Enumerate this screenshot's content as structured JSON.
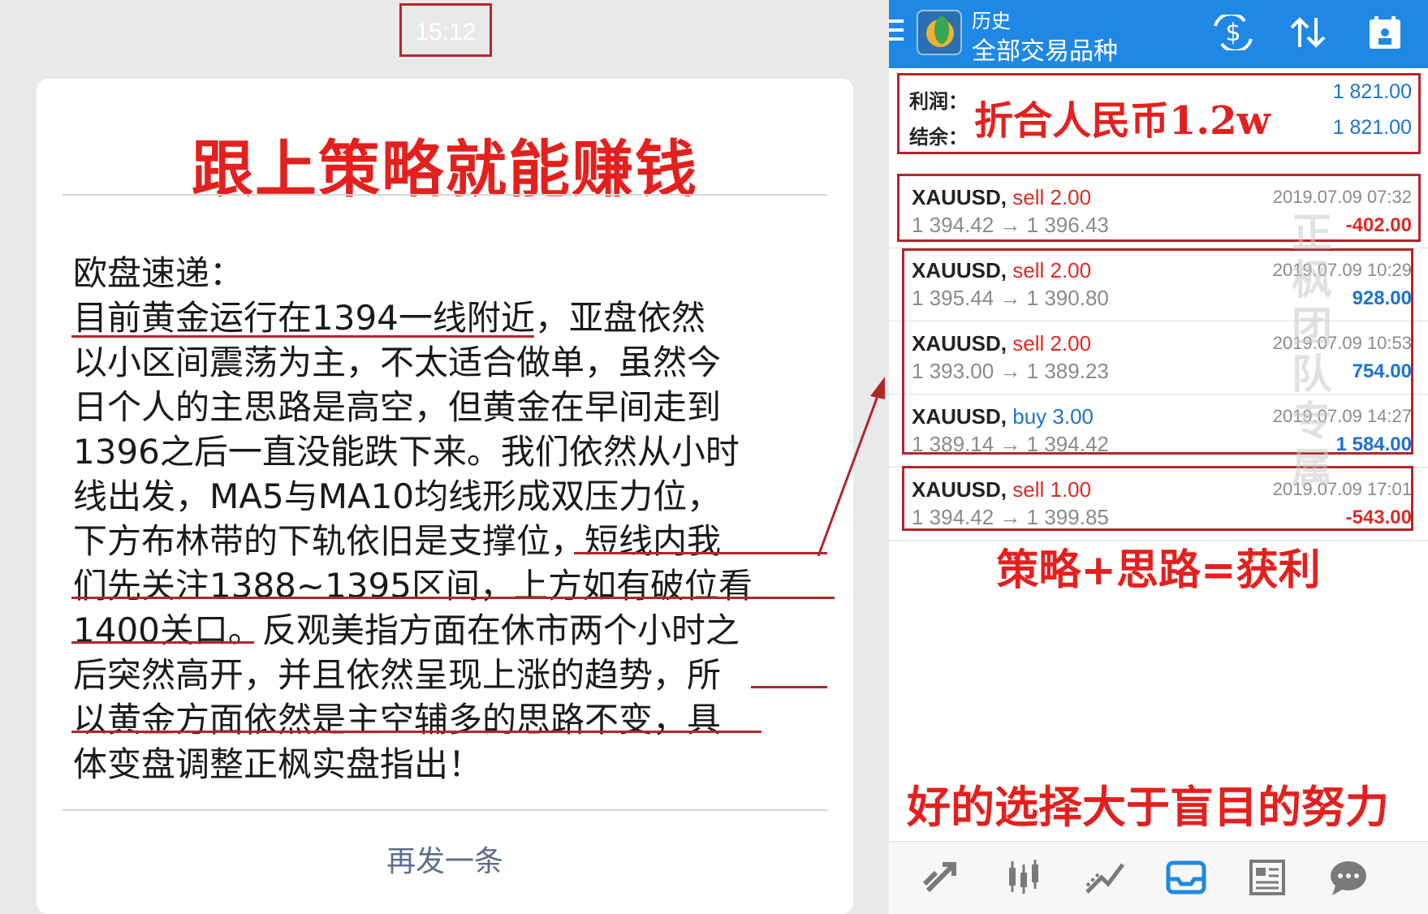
{
  "left": {
    "time": "15:12",
    "title": "跟上策略就能赚钱",
    "lines": [
      "欧盘速递：",
      "目前黄金运行在1394一线附近，亚盘依然",
      "以小区间震荡为主，不太适合做单，虽然今",
      "日个人的主思路是高空，但黄金在早间走到",
      "1396之后一直没能跌下来。我们依然从小时",
      "线出发，MA5与MA10均线形成双压力位，",
      "下方布林带的下轨依旧是支撑位，短线内我",
      "们先关注1388~1395区间，上方如有破位看",
      "1400关口。反观美指方面在休市两个小时之",
      "后突然高开，并且依然呈现上涨的趋势，所",
      "以黄金方面依然是主空辅多的思路不变，具",
      "体变盘调整正枫实盘指出！"
    ],
    "resend": "再发一条"
  },
  "app": {
    "title": "历史",
    "subtitle": "全部交易品种",
    "icons": [
      "currency-exchange-icon",
      "sort-icon",
      "calendar-icon"
    ],
    "summary": {
      "profit_label": "利润：",
      "balance_label": "结余：",
      "profit_value": "1 821.00",
      "balance_value": "1 821.00",
      "note": "折合人民币1.2w"
    },
    "trades": [
      {
        "symbol": "XAUUSD,",
        "side": "sell 2.00",
        "side_type": "sell",
        "prices": "1 394.42 → 1 396.43",
        "time": "2019.07.09 07:32",
        "profit": "-402.00",
        "profit_type": "neg"
      },
      {
        "symbol": "XAUUSD,",
        "side": "sell 2.00",
        "side_type": "sell",
        "prices": "1 395.44 → 1 390.80",
        "time": "2019.07.09 10:29",
        "profit": "928.00",
        "profit_type": "pos"
      },
      {
        "symbol": "XAUUSD,",
        "side": "sell 2.00",
        "side_type": "sell",
        "prices": "1 393.00 → 1 389.23",
        "time": "2019.07.09 10:53",
        "profit": "754.00",
        "profit_type": "pos"
      },
      {
        "symbol": "XAUUSD,",
        "side": "buy 3.00",
        "side_type": "buy",
        "prices": "1 389.14 → 1 394.42",
        "time": "2019.07.09 14:27",
        "profit": "1 584.00",
        "profit_type": "pos"
      },
      {
        "symbol": "XAUUSD,",
        "side": "sell 1.00",
        "side_type": "sell",
        "prices": "1 394.42 → 1 399.85",
        "time": "2019.07.09 17:01",
        "profit": "-543.00",
        "profit_type": "neg"
      }
    ],
    "watermark": "正枫团队专属",
    "note1": "策略+思路=获利",
    "note2": "好的选择大于盲目的努力",
    "nav": [
      "trade-icon",
      "chart-candles-icon",
      "trend-icon",
      "history-inbox-icon",
      "news-icon",
      "chat-icon"
    ]
  },
  "colors": {
    "accent_red": "#e4201e",
    "frame_red": "#b3262a",
    "app_blue": "#1f88e5",
    "profit_blue": "#1c73d2",
    "loss_red": "#e02a24"
  }
}
